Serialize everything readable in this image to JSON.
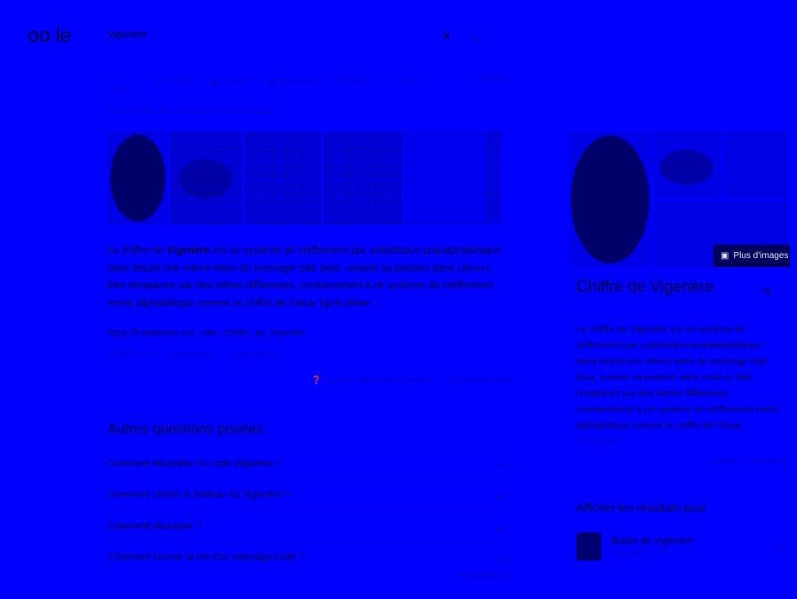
{
  "header": {
    "logo": "oo le",
    "query": "Vigenère",
    "icons": {
      "clear": "close-icon",
      "search": "chevron-down-icon"
    }
  },
  "tabs": [
    {
      "label": "",
      "icon": "search-icon"
    },
    {
      "label": "Images",
      "icon": "image-icon"
    },
    {
      "label": "Vidéos",
      "icon": "video-icon"
    },
    {
      "label": "Actualités",
      "icon": "news-icon"
    },
    {
      "label": "Maps",
      "icon": "map-pin-icon"
    },
    {
      "label": "Plus",
      "icon": "more-icon"
    }
  ],
  "tools_label": "Outils",
  "stats": "Environ 469 000 résultats (0,49 secondes)",
  "snippet": {
    "pre": "Le chiffre de ",
    "bold": "Vigenère",
    "post": " est un système de chiffrement par substitution polyalphabétique dans lequel une même lettre du message clair peut, suivant sa position dans celui-ci, être remplacée par des lettres différentes, contrairement à un système de chiffrement mono alphabétique comme le chiffre de César (qu'il utilise ...",
    "url": "https://fr.wikipedia.org › wiki › Chiffre_de_Vigenère",
    "title": "Chiffre de Vigenère - Wikipédia",
    "about": "À propos des extraits optimisés",
    "comments": "Commentaires"
  },
  "paa": {
    "title": "Autres questions posées",
    "items": [
      "Comment décrypter un code Vigenère ?",
      "Comment utiliser le tableau de Vigenère ?",
      "Comment décrypter ?",
      "Comment trouver la clé d'un message codé ?"
    ],
    "comments": "Commentaires"
  },
  "knowledge_panel": {
    "more_images": "Plus d'images",
    "title": "Chiffre de Vigenère",
    "description": "Le chiffre de Vigenère est un système de chiffrement par substitution polyalphabétique dans lequel une même lettre du message clair peut, suivant sa position dans celui-ci, être remplacée par des lettres différentes, contrairement à un système de chiffrement mono alphabétique comme le chiffre de César. ",
    "source": "Wikipédia",
    "feedback": "Signaler un problème",
    "results_for": "Afficher les résultats pour",
    "entity": {
      "name": "Blaise de Vigenère",
      "sub": "Diplomate"
    }
  }
}
